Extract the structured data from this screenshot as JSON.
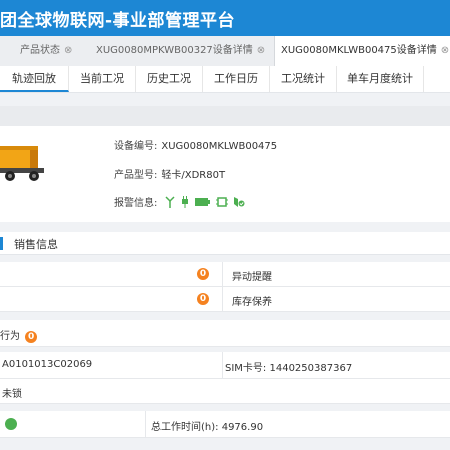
{
  "app": {
    "title": "团全球物联网-事业部管理平台"
  },
  "page_tabs": [
    {
      "label": "产品状态",
      "closable": true,
      "active": false
    },
    {
      "label": "XUG0080MPKWB00327设备详情",
      "closable": true,
      "active": false
    },
    {
      "label": "XUG0080MKLWB00475设备详情",
      "closable": true,
      "active": true
    }
  ],
  "sub_tabs": [
    "轨迹回放",
    "当前工况",
    "历史工况",
    "工作日历",
    "工况统计",
    "单车月度统计"
  ],
  "device": {
    "number_label": "设备编号:",
    "number_value": "XUG0080MKLWB00475",
    "model_label": "产品型号:",
    "model_value": "轻卡/XDR80T",
    "alarm_label": "报警信息:",
    "alarm_icons": [
      "signal-icon",
      "plug-icon",
      "battery-icon",
      "chip-icon",
      "shield-icon"
    ]
  },
  "sales_section": {
    "title": "销售信息"
  },
  "rows": {
    "startup_badge": "0",
    "startup_label": "异动提醒",
    "stock_badge": "0",
    "stock_label": "库存保养",
    "behavior_label": "行为",
    "behavior_badge": "0",
    "terminal_value": "A0101013C02069",
    "sim_label": "SIM卡号:",
    "sim_value": "1440250387367",
    "lock_status": "未锁",
    "total_hours_label": "总工作时间(h):",
    "total_hours_value": "4976.90"
  },
  "colors": {
    "brand": "#1d87d4",
    "badge": "#f58220",
    "ok": "#4caf50"
  }
}
